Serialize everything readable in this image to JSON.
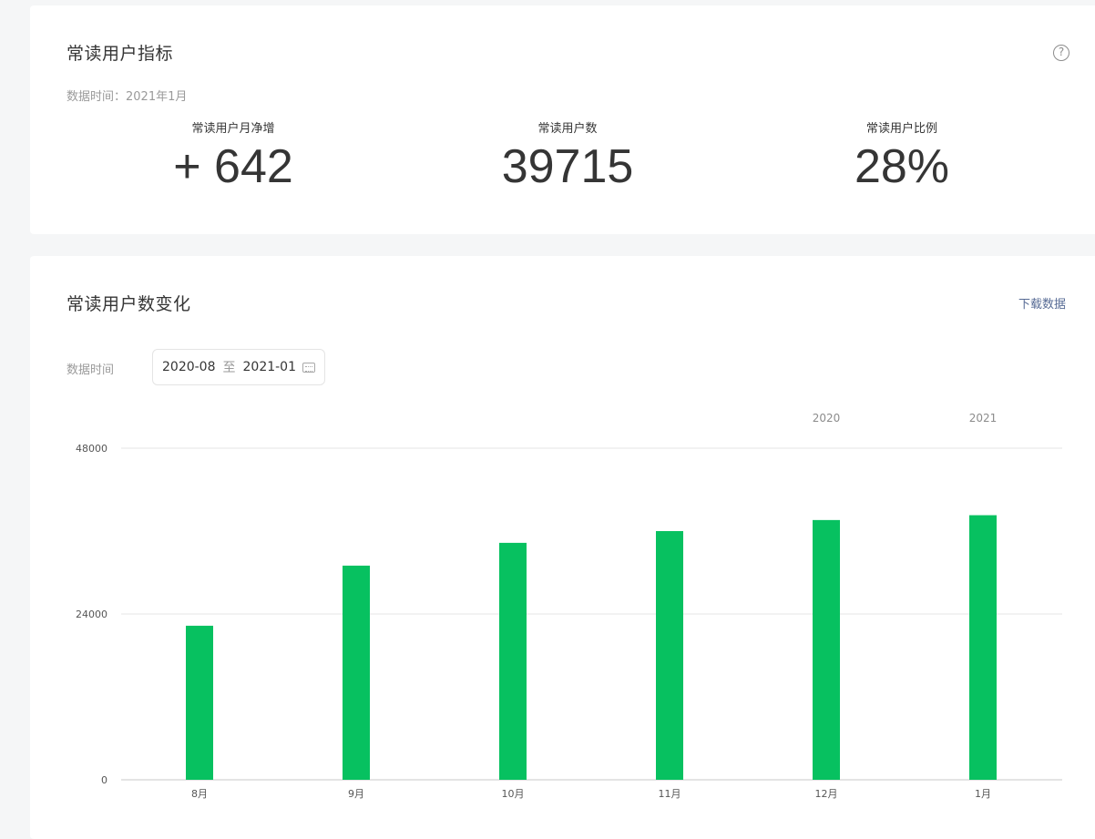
{
  "metrics": {
    "title": "常读用户指标",
    "help_icon": "question-circle-icon",
    "data_time": "数据时间：2021年1月",
    "items": [
      {
        "label": "常读用户月净增",
        "value": "+ 642"
      },
      {
        "label": "常读用户数",
        "value": "39715"
      },
      {
        "label": "常读用户比例",
        "value": "28%"
      }
    ]
  },
  "trend": {
    "title": "常读用户数变化",
    "download_label": "下载数据",
    "filter_label": "数据时间",
    "date_start": "2020-08",
    "date_sep": "至",
    "date_end": "2021-01",
    "calendar_icon": "calendar-icon"
  },
  "chart_data": {
    "type": "bar",
    "categories": [
      "8月",
      "9月",
      "10月",
      "11月",
      "12月",
      "1月"
    ],
    "values": [
      22300,
      31000,
      34300,
      36000,
      37600,
      38300
    ],
    "year_labels": [
      {
        "label": "2020",
        "category_index": 4
      },
      {
        "label": "2021",
        "category_index": 5
      }
    ],
    "yticks": [
      0,
      24000,
      48000
    ],
    "ylim": [
      0,
      48000
    ],
    "grid": true,
    "color": "#07c160"
  }
}
